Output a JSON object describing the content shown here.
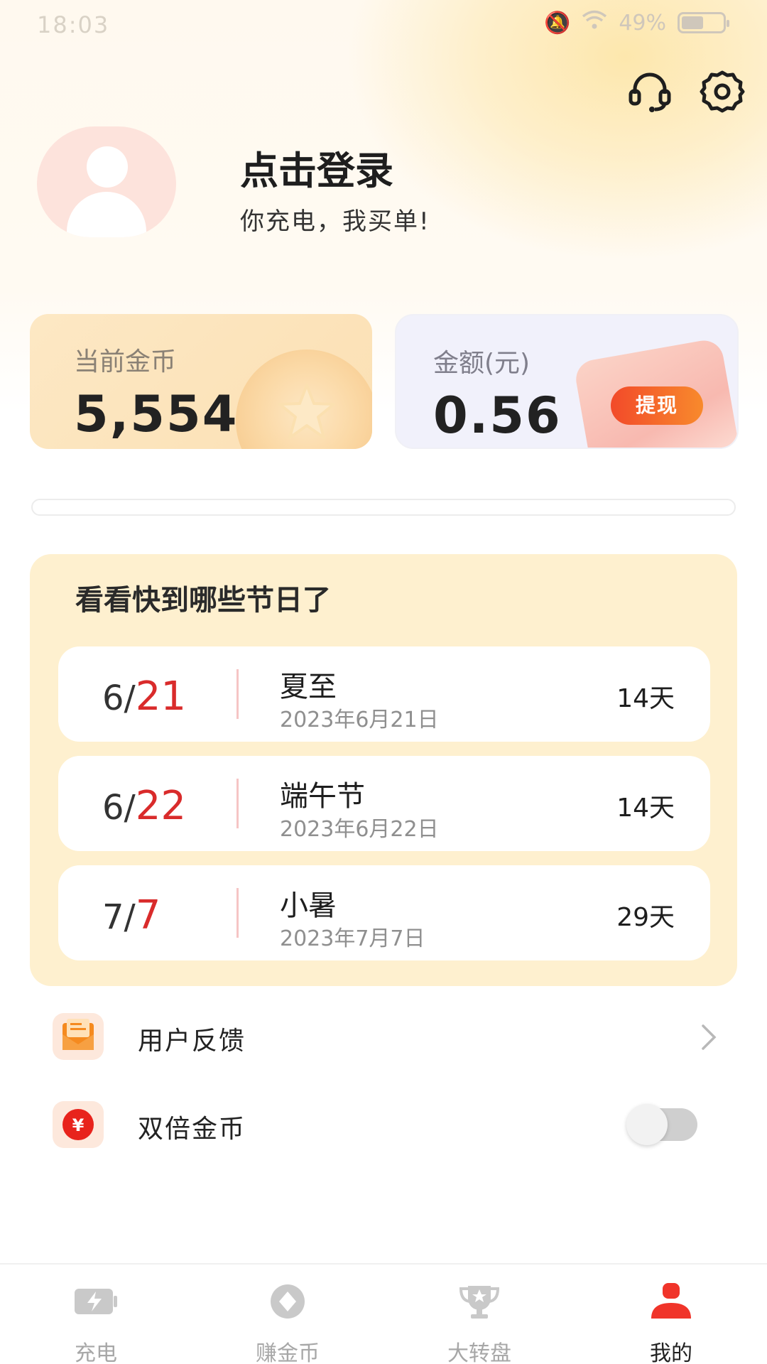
{
  "status_bar": {
    "time": "18:03",
    "battery": "49%"
  },
  "profile": {
    "login_label": "点击登录",
    "slogan": "你充电，我买单!"
  },
  "coins_card": {
    "label": "当前金币",
    "value": "5,554"
  },
  "money_card": {
    "label": "金额(元)",
    "value": "0.56",
    "withdraw_label": "提现"
  },
  "holidays": {
    "title": "看看快到哪些节日了",
    "items": [
      {
        "month": "6/",
        "day": "21",
        "name": "夏至",
        "date": "2023年6月21日",
        "days": "14天"
      },
      {
        "month": "6/",
        "day": "22",
        "name": "端午节",
        "date": "2023年6月22日",
        "days": "14天"
      },
      {
        "month": "7/",
        "day": "7",
        "name": "小暑",
        "date": "2023年7月7日",
        "days": "29天"
      }
    ]
  },
  "menu": {
    "feedback_label": "用户反馈",
    "double_coins_label": "双倍金币",
    "double_coins_enabled": false
  },
  "tabs": [
    {
      "label": "充电",
      "icon": "battery-charge-icon",
      "active": false
    },
    {
      "label": "赚金币",
      "icon": "earn-coin-icon",
      "active": false
    },
    {
      "label": "大转盘",
      "icon": "trophy-icon",
      "active": false
    },
    {
      "label": "我的",
      "icon": "person-icon",
      "active": true
    }
  ],
  "colors": {
    "accent_red": "#d92b2b",
    "withdraw_gradient_start": "#f24a2a",
    "panel_bg": "#fef0cf",
    "tab_active_icon": "#f0342a"
  }
}
